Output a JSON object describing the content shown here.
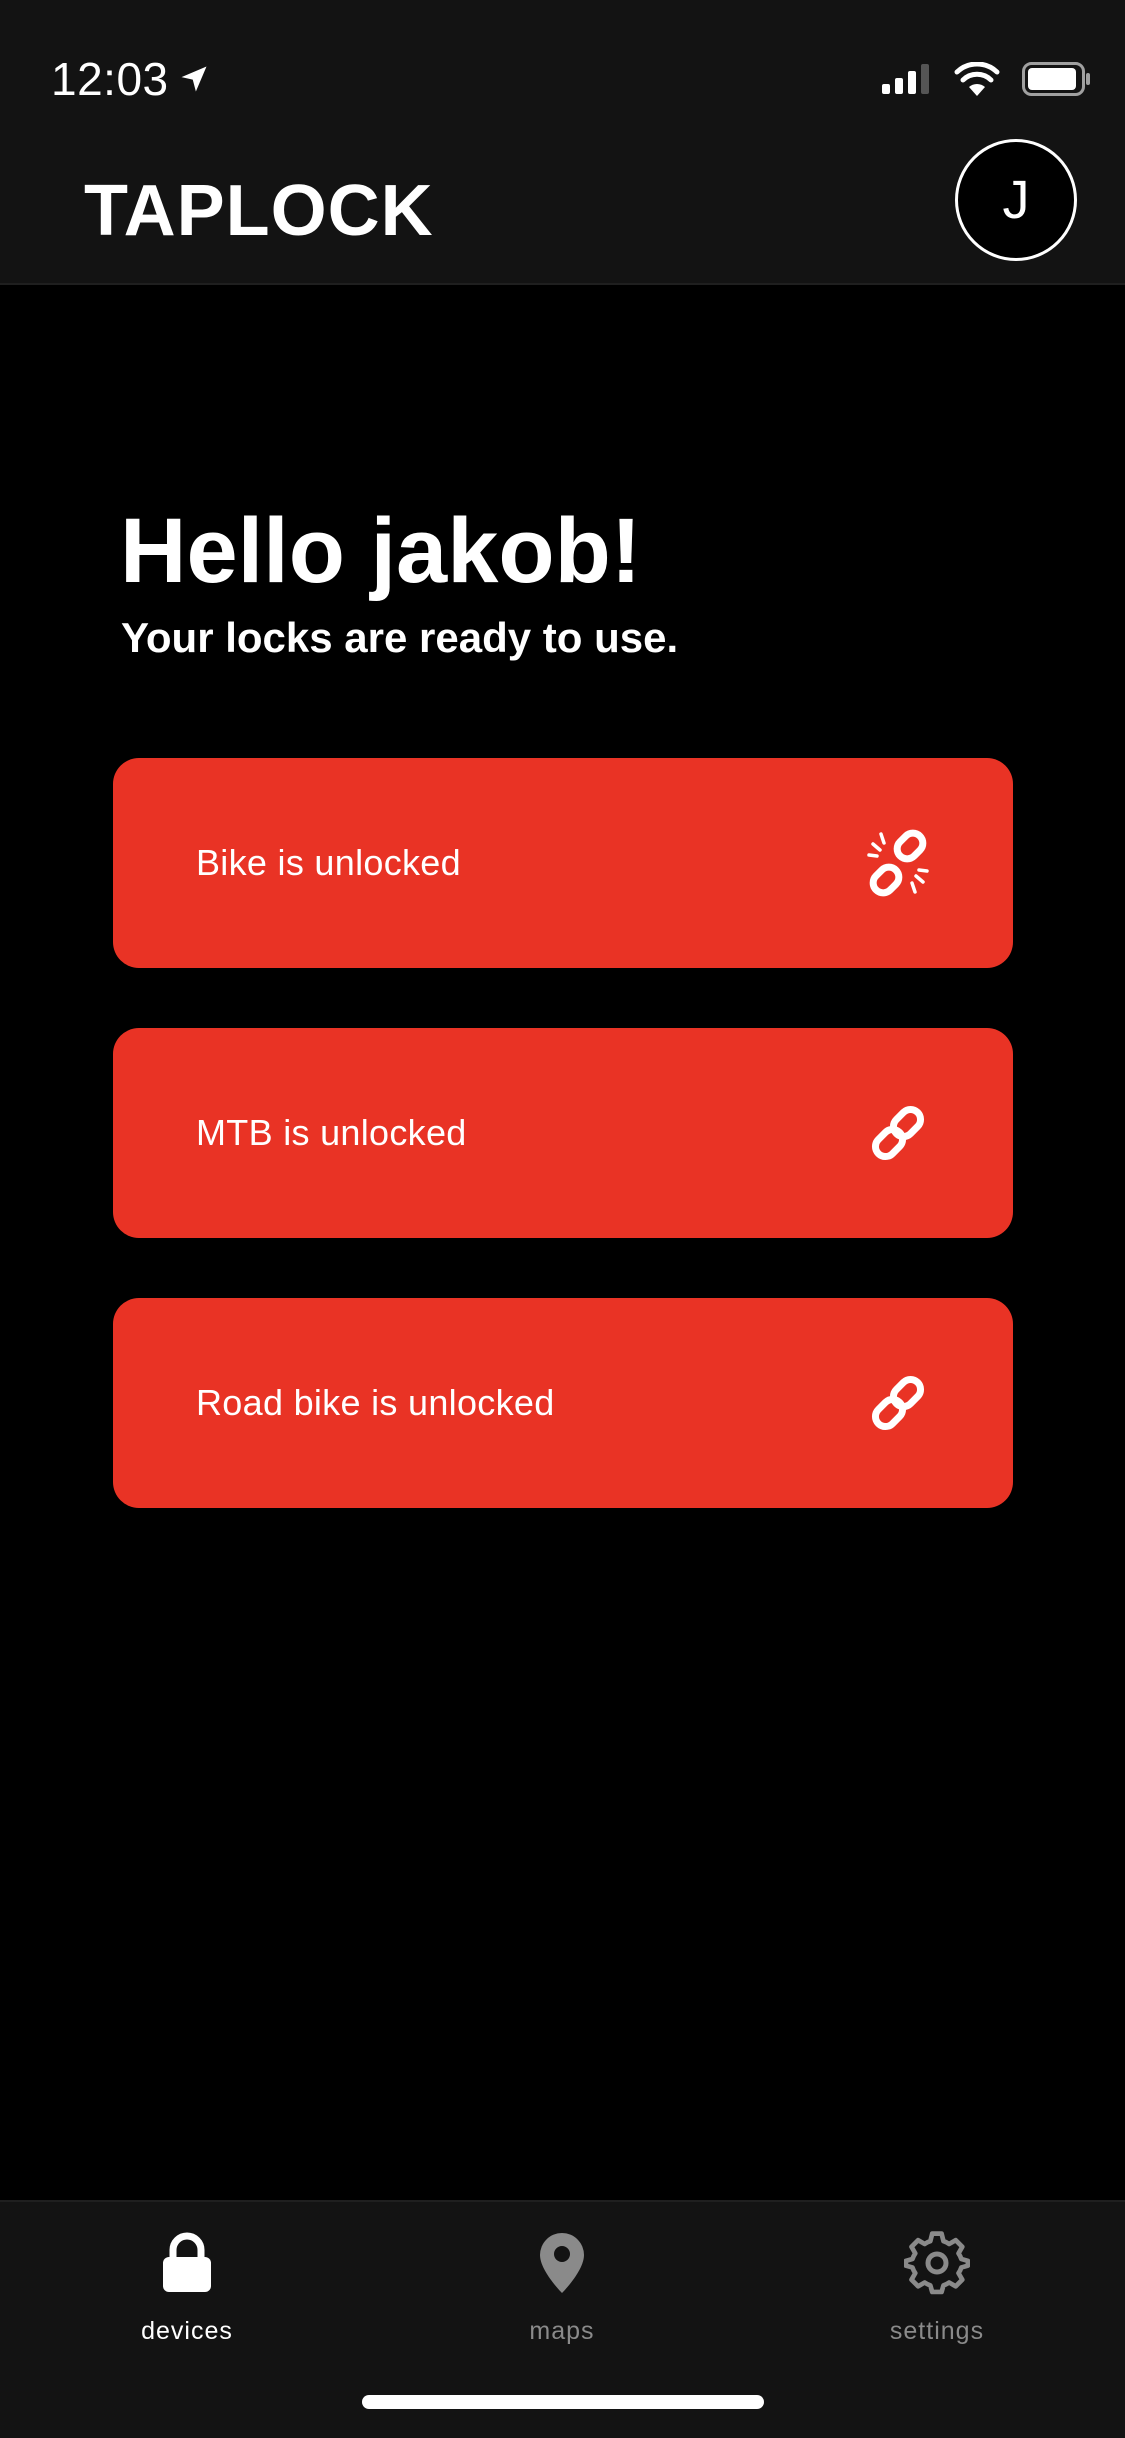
{
  "status_bar": {
    "time": "12:03",
    "location_icon": "location-arrow-icon",
    "signal_icon": "cellular-signal-icon",
    "wifi_icon": "wifi-icon",
    "battery_icon": "battery-icon"
  },
  "header": {
    "title": "TAPLOCK",
    "avatar_initial": "J"
  },
  "main": {
    "greeting": "Hello jakob!",
    "subtitle": "Your locks are ready to use.",
    "locks": [
      {
        "label": "Bike is unlocked",
        "icon": "broken-link-icon"
      },
      {
        "label": "MTB is unlocked",
        "icon": "link-icon"
      },
      {
        "label": "Road bike is unlocked",
        "icon": "link-icon"
      }
    ]
  },
  "tabbar": {
    "tabs": [
      {
        "label": "devices",
        "icon": "lock-icon",
        "active": true
      },
      {
        "label": "maps",
        "icon": "map-pin-icon",
        "active": false
      },
      {
        "label": "settings",
        "icon": "gear-icon",
        "active": false
      }
    ]
  },
  "colors": {
    "accent": "#e93325",
    "background": "#000000",
    "bar_background": "#131313",
    "active_tab": "#ffffff",
    "inactive_tab": "#8a8a8a"
  }
}
